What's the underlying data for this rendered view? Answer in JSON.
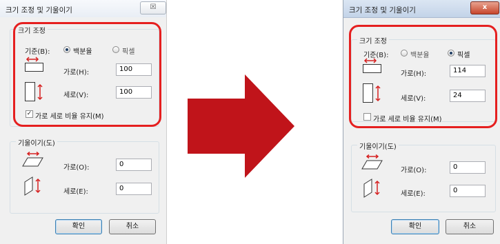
{
  "colors": {
    "highlight": "#e51f1f",
    "arrow": "#c0141a",
    "dialog_bg": "#f0f0f0"
  },
  "before": {
    "title": "크기 조정 및 기울이기",
    "close_label": "☒",
    "resize": {
      "group_label": "크기 조정",
      "basis_label": "기준(B):",
      "option_percent": "백분율",
      "option_pixel": "픽셀",
      "selected": "백분율",
      "horizontal_label": "가로(H):",
      "horizontal_value": "100",
      "vertical_label": "세로(V):",
      "vertical_value": "100",
      "keep_ratio_label": "가로 세로 비율 유지(M)",
      "keep_ratio_checked": true
    },
    "skew": {
      "group_label": "기울이기(도)",
      "horizontal_label": "가로(O):",
      "horizontal_value": "0",
      "vertical_label": "세로(E):",
      "vertical_value": "0"
    },
    "ok_label": "확인",
    "cancel_label": "취소"
  },
  "after": {
    "title": "크기 조정 및 기울이기",
    "close_label": "x",
    "resize": {
      "group_label": "크기 조정",
      "basis_label": "기준(B):",
      "option_percent": "백분율",
      "option_pixel": "픽셀",
      "selected": "픽셀",
      "horizontal_label": "가로(H):",
      "horizontal_value": "114",
      "vertical_label": "세로(V):",
      "vertical_value": "24",
      "keep_ratio_label": "가로 세로 비율 유지(M)",
      "keep_ratio_checked": false
    },
    "skew": {
      "group_label": "기울이기(도)",
      "horizontal_label": "가로(O):",
      "horizontal_value": "0",
      "vertical_label": "세로(E):",
      "vertical_value": "0"
    },
    "ok_label": "확인",
    "cancel_label": "취소"
  }
}
